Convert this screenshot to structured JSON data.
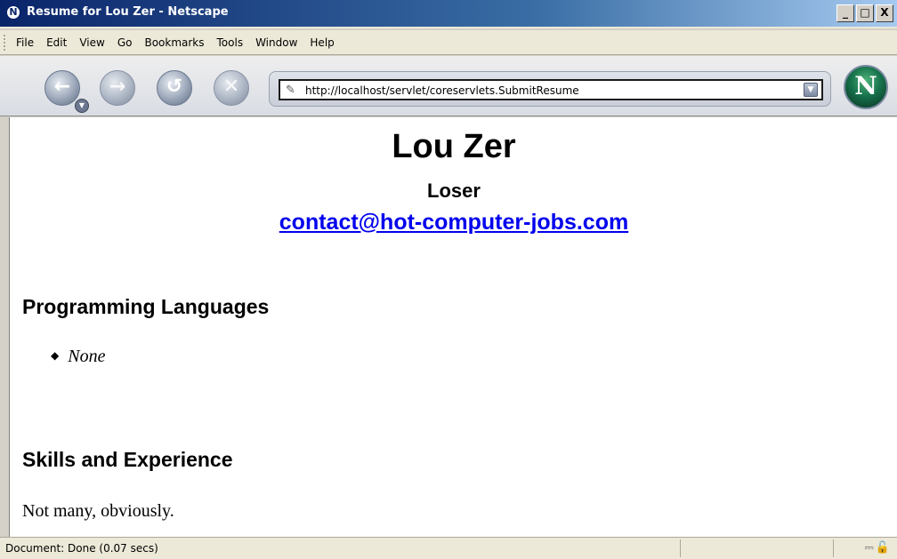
{
  "window": {
    "title": "Resume for Lou Zer - Netscape",
    "buttons": [
      "_",
      "□",
      "X"
    ]
  },
  "menu": {
    "items": [
      "File",
      "Edit",
      "View",
      "Go",
      "Bookmarks",
      "Tools",
      "Window",
      "Help"
    ]
  },
  "toolbar": {
    "url": "http://localhost/servlet/coreservlets.SubmitResume",
    "icons": [
      "back-icon",
      "forward-icon",
      "reload-icon",
      "stop-icon",
      "netscape-throbber-icon"
    ]
  },
  "page": {
    "name": "Lou Zer",
    "job_title": "Loser",
    "email": "contact@hot-computer-jobs.com",
    "sections": [
      {
        "heading": "Programming Languages",
        "items": [
          "None"
        ]
      },
      {
        "heading": "Skills and Experience",
        "text": "Not many, obviously."
      }
    ]
  },
  "status": {
    "text": "Document: Done (0.07 secs)"
  }
}
